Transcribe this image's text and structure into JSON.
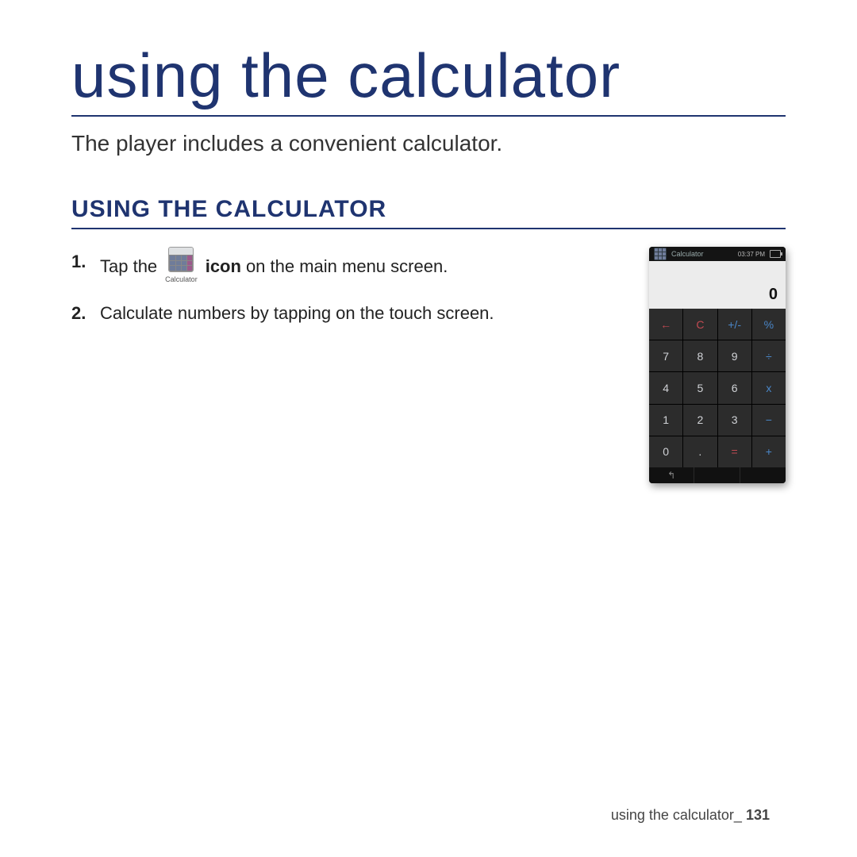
{
  "page": {
    "title": "using the calculator",
    "subtitle": "The player includes a convenient calculator.",
    "section": "USING THE CALCULATOR"
  },
  "steps": {
    "s1": {
      "num": "1.",
      "a": "Tap the",
      "icon_label": "Calculator",
      "b": "icon",
      "c": "on the main menu screen."
    },
    "s2": {
      "num": "2.",
      "text": "Calculate numbers by tapping on the touch screen."
    }
  },
  "phone": {
    "status": {
      "title": "Calculator",
      "time": "03:37 PM"
    },
    "display": "0",
    "keys": {
      "r1": {
        "k1": "←",
        "k2": "C",
        "k3": "+/-",
        "k4": "%"
      },
      "r2": {
        "k1": "7",
        "k2": "8",
        "k3": "9",
        "k4": "÷"
      },
      "r3": {
        "k1": "4",
        "k2": "5",
        "k3": "6",
        "k4": "x"
      },
      "r4": {
        "k1": "1",
        "k2": "2",
        "k3": "3",
        "k4": "−"
      },
      "r5": {
        "k1": "0",
        "k2": ".",
        "k3": "=",
        "k4": "+"
      }
    },
    "soft": {
      "back": "↰"
    }
  },
  "footer": {
    "label": "using the calculator_",
    "page": "131"
  }
}
